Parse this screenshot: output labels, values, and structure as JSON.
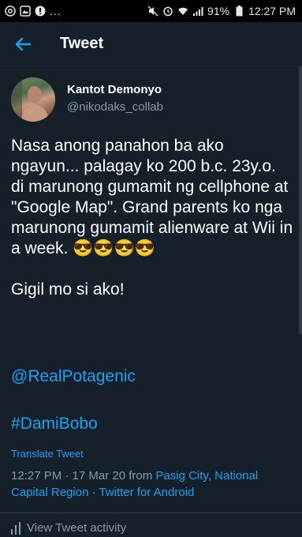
{
  "status_bar": {
    "left_icons": [
      "at-icon",
      "gallery-icon",
      "notification-icon"
    ],
    "overflow": "...",
    "right_icons": [
      "mute-icon",
      "alarm-icon",
      "wifi-icon",
      "signal-icon"
    ],
    "battery": "91%",
    "time": "12:27 PM"
  },
  "appbar": {
    "back_icon": "arrow-left-icon",
    "title": "Tweet"
  },
  "tweet": {
    "display_name": "Kantot Demonyo",
    "handle": "@nikodaks_collab",
    "text": "Nasa anong panahon ba ako ngayun... palagay ko 200 b.c. 23y.o. di marunong gumamit ng cellphone at \"Google Map\". Grand parents ko nga marunong gumamit alienware at Wii in a week. 😎😎😎😎\n\nGigil mo si ako!",
    "mention": "@RealPotagenic",
    "hashtag": "#DamiBobo",
    "translate_label": "Translate Tweet",
    "timestamp": "12:27 PM · 17 Mar 20 from ",
    "location": "Pasig City, National Capital Region",
    "separator": " · ",
    "client": "Twitter for Android",
    "activity_label": "View Tweet activity"
  },
  "colors": {
    "background": "#15202b",
    "accent": "#1da1f2",
    "secondary_text": "#8899a6"
  }
}
